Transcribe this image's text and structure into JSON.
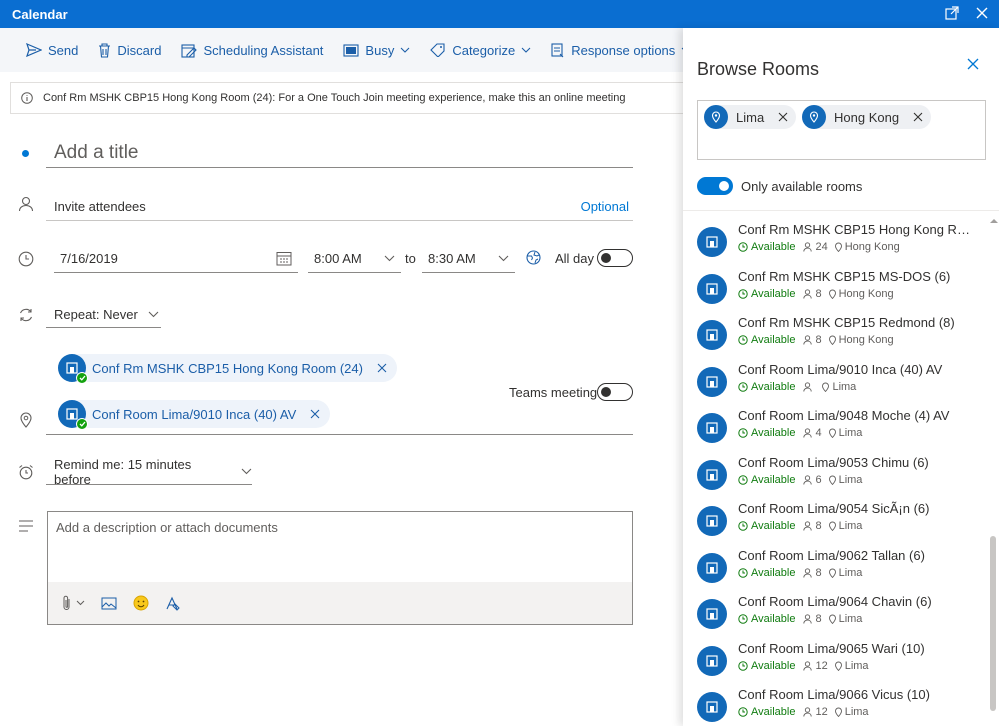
{
  "window": {
    "title": "Calendar"
  },
  "toolbar": {
    "send": "Send",
    "discard": "Discard",
    "scheduling": "Scheduling Assistant",
    "busy": "Busy",
    "categorize": "Categorize",
    "response": "Response options"
  },
  "info": {
    "message": "Conf Rm MSHK CBP15 Hong Kong Room (24): For a One Touch Join meeting experience, make this an online meeting"
  },
  "form": {
    "title_placeholder": "Add a title",
    "attendees_placeholder": "Invite attendees",
    "optional": "Optional",
    "date": "7/16/2019",
    "start_time": "8:00 AM",
    "to": "to",
    "end_time": "8:30 AM",
    "all_day": "All day",
    "repeat": "Repeat:  Never",
    "locations": [
      {
        "name": "Conf Rm MSHK CBP15 Hong Kong Room (24)"
      },
      {
        "name": "Conf Room Lima/9010 Inca (40) AV"
      }
    ],
    "teams_meeting": "Teams meeting",
    "remind": "Remind me:  15 minutes before",
    "description_placeholder": "Add a description or attach documents"
  },
  "panel": {
    "title": "Browse Rooms",
    "filters": [
      "Lima",
      "Hong Kong"
    ],
    "only_available": "Only available rooms",
    "rooms": [
      {
        "name": "Conf Rm MSHK CBP15 Hong Kong Roo...",
        "status": "Available",
        "capacity": "24",
        "location": "Hong Kong"
      },
      {
        "name": "Conf Rm MSHK CBP15 MS-DOS (6)",
        "status": "Available",
        "capacity": "8",
        "location": "Hong Kong"
      },
      {
        "name": "Conf Rm MSHK CBP15 Redmond (8)",
        "status": "Available",
        "capacity": "8",
        "location": "Hong Kong"
      },
      {
        "name": "Conf Room Lima/9010 Inca (40) AV",
        "status": "Available",
        "capacity": "",
        "location": "Lima"
      },
      {
        "name": "Conf Room Lima/9048 Moche (4) AV",
        "status": "Available",
        "capacity": "4",
        "location": "Lima"
      },
      {
        "name": "Conf Room Lima/9053 Chimu (6)",
        "status": "Available",
        "capacity": "6",
        "location": "Lima"
      },
      {
        "name": "Conf Room Lima/9054 SicÃ¡n (6)",
        "status": "Available",
        "capacity": "8",
        "location": "Lima"
      },
      {
        "name": "Conf Room Lima/9062 Tallan (6)",
        "status": "Available",
        "capacity": "8",
        "location": "Lima"
      },
      {
        "name": "Conf Room Lima/9064 Chavin (6)",
        "status": "Available",
        "capacity": "8",
        "location": "Lima"
      },
      {
        "name": "Conf Room Lima/9065 Wari (10)",
        "status": "Available",
        "capacity": "12",
        "location": "Lima"
      },
      {
        "name": "Conf Room Lima/9066 Vicus (10)",
        "status": "Available",
        "capacity": "12",
        "location": "Lima"
      }
    ]
  },
  "colors": {
    "accent": "#0078d4",
    "titlebar": "#0a6ed1",
    "available": "#107c10"
  }
}
